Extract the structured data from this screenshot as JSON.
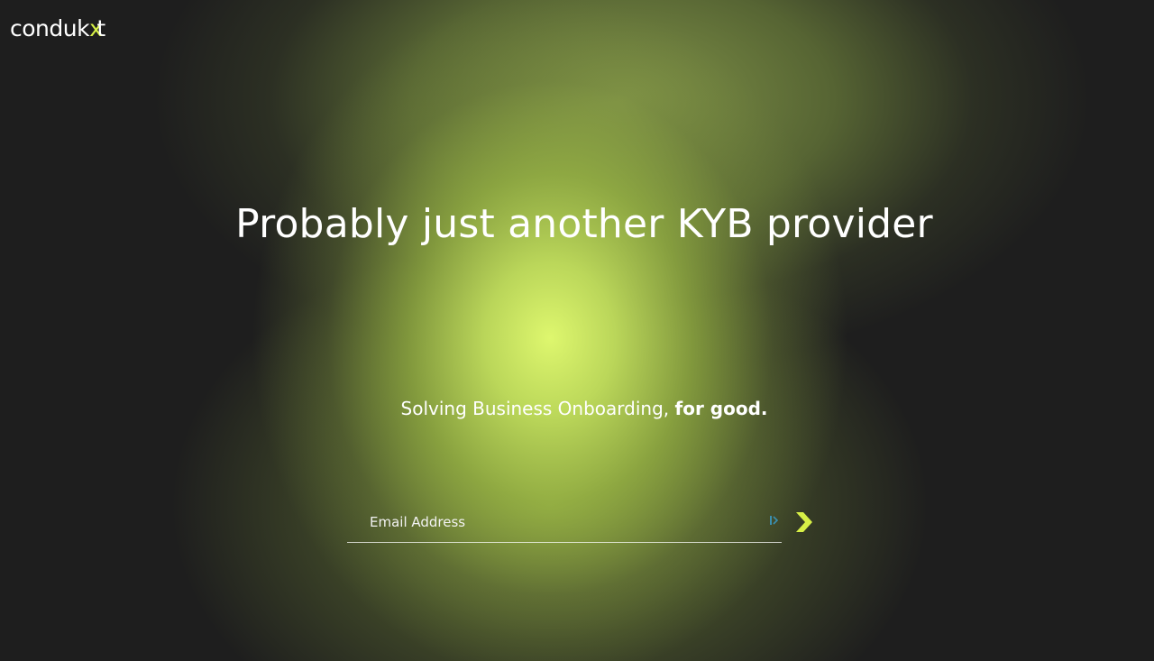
{
  "brand": {
    "logo_prefix": "condu",
    "logo_k": "k",
    "logo_accent": "x",
    "logo_suffix": "t",
    "accent_color": "#d7f046"
  },
  "hero": {
    "headline": "Probably just another KYB provider",
    "tagline_regular": "Solving Business Onboarding, ",
    "tagline_bold": "for good."
  },
  "signup": {
    "email_placeholder": "Email Address",
    "email_value": "",
    "submit_icon": "chevron-right-icon",
    "autofill_icon": "autofill-key-icon"
  },
  "colors": {
    "background": "#1e1e1e",
    "glow": "#def76e",
    "text": "#ffffff"
  }
}
